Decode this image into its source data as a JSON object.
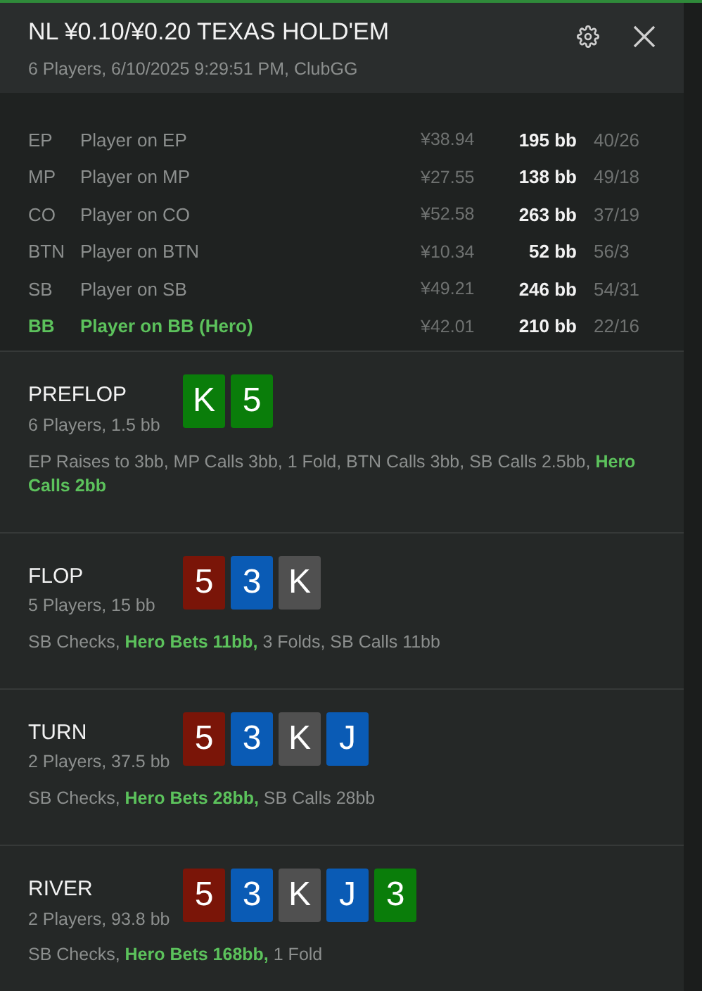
{
  "header": {
    "title": "NL ¥0.10/¥0.20 TEXAS HOLD'EM",
    "subtitle": "6 Players, 6/10/2025 9:29:51 PM, ClubGG"
  },
  "players": [
    {
      "position": "EP",
      "name": "Player on EP",
      "stack": "¥38.94",
      "bb": "195 bb",
      "stats": "40/26",
      "hero": false
    },
    {
      "position": "MP",
      "name": "Player on MP",
      "stack": "¥27.55",
      "bb": "138 bb",
      "stats": "49/18",
      "hero": false
    },
    {
      "position": "CO",
      "name": "Player on CO",
      "stack": "¥52.58",
      "bb": "263 bb",
      "stats": "37/19",
      "hero": false
    },
    {
      "position": "BTN",
      "name": "Player on BTN",
      "stack": "¥10.34",
      "bb": "52 bb",
      "stats": "56/3",
      "hero": false
    },
    {
      "position": "SB",
      "name": "Player on SB",
      "stack": "¥49.21",
      "bb": "246 bb",
      "stats": "54/31",
      "hero": false
    },
    {
      "position": "BB",
      "name": "Player on BB (Hero)",
      "stack": "¥42.01",
      "bb": "210 bb",
      "stats": "22/16",
      "hero": true
    }
  ],
  "streets": [
    {
      "name": "PREFLOP",
      "info": "6 Players, 1.5 bb",
      "cards": [
        {
          "rank": "K",
          "color": "#0a7d0a"
        },
        {
          "rank": "5",
          "color": "#0a7d0a"
        }
      ],
      "actions": "EP Raises to 3bb, MP Calls 3bb, 1 Fold, BTN Calls 3bb, SB Calls 2.5bb, **Hero Calls 2bb**"
    },
    {
      "name": "FLOP",
      "info": "5 Players, 15 bb",
      "cards": [
        {
          "rank": "5",
          "color": "#7a1508"
        },
        {
          "rank": "3",
          "color": "#0a5bb5"
        },
        {
          "rank": "K",
          "color": "#505050"
        }
      ],
      "actions": "SB Checks, **Hero Bets 11bb,** 3 Folds, SB Calls 11bb"
    },
    {
      "name": "TURN",
      "info": "2 Players, 37.5 bb",
      "cards": [
        {
          "rank": "5",
          "color": "#7a1508"
        },
        {
          "rank": "3",
          "color": "#0a5bb5"
        },
        {
          "rank": "K",
          "color": "#505050"
        },
        {
          "rank": "J",
          "color": "#0a5bb5"
        }
      ],
      "actions": "SB Checks, **Hero Bets 28bb,** SB Calls 28bb"
    },
    {
      "name": "RIVER",
      "info": "2 Players, 93.8 bb",
      "cards": [
        {
          "rank": "5",
          "color": "#7a1508"
        },
        {
          "rank": "3",
          "color": "#0a5bb5"
        },
        {
          "rank": "K",
          "color": "#505050"
        },
        {
          "rank": "J",
          "color": "#0a5bb5"
        },
        {
          "rank": "3",
          "color": "#0a7d0a"
        }
      ],
      "actions": "SB Checks, **Hero Bets 168bb,** 1 Fold"
    }
  ]
}
